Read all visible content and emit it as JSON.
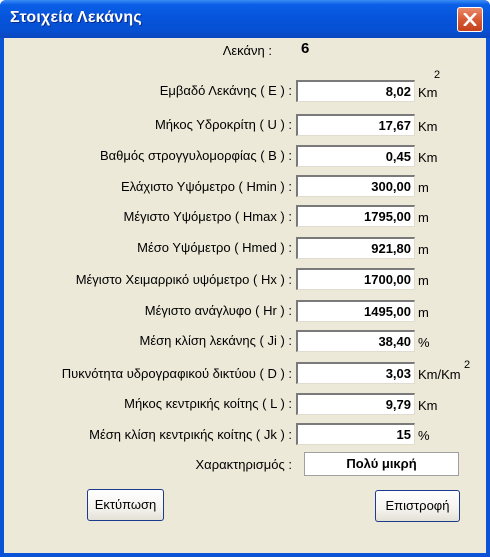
{
  "window": {
    "title": "Στοιχεία Λεκάνης"
  },
  "basin": {
    "label": "Λεκάνη :",
    "value": "6"
  },
  "fields": [
    {
      "label": "Εμβαδό Λεκάνης ( E ) :",
      "value": "8,02",
      "unit": "Km",
      "sup": "2"
    },
    {
      "label": "Μήκος Υδροκρίτη ( U ) :",
      "value": "17,67",
      "unit": "Km"
    },
    {
      "label": "Βαθμός στρογγυλομορφίας ( B ) :",
      "value": "0,45",
      "unit": "Km"
    },
    {
      "label": "Ελάχιστο Υψόμετρο ( Hmin ) :",
      "value": "300,00",
      "unit": "m"
    },
    {
      "label": "Μέγιστο Υψόμετρο ( Hmax ) :",
      "value": "1795,00",
      "unit": "m"
    },
    {
      "label": "Μέσο Υψόμετρο ( Hmed ) :",
      "value": "921,80",
      "unit": "m"
    },
    {
      "label": "Μέγιστο Χειμαρρικό υψόμετρο ( Hx ) :",
      "value": "1700,00",
      "unit": "m"
    },
    {
      "label": "Μέγιστο ανάγλυφο ( Hr ) :",
      "value": "1495,00",
      "unit": "m"
    },
    {
      "label": "Μέση κλίση λεκάνης ( Ji ) :",
      "value": "38,40",
      "unit": "%"
    },
    {
      "label": "Πυκνότητα υδρογραφικού δικτύου ( D ) :",
      "value": "3,03",
      "unit": "Km/Km",
      "sup": "2"
    },
    {
      "label": "Μήκος κεντρικής κοίτης ( L ) :",
      "value": "9,79",
      "unit": "Km"
    },
    {
      "label": "Μέση κλίση κεντρικής κοίτης ( Jk ) :",
      "value": "15",
      "unit": "%"
    }
  ],
  "characterization": {
    "label": "Χαρακτηρισμός :",
    "value": "Πολύ μικρή"
  },
  "buttons": {
    "print": "Εκτύπωση",
    "back": "Επιστροφή"
  },
  "colors": {
    "titlebar": "#0654dc",
    "client": "#ece9d8",
    "close": "#d85a34"
  }
}
